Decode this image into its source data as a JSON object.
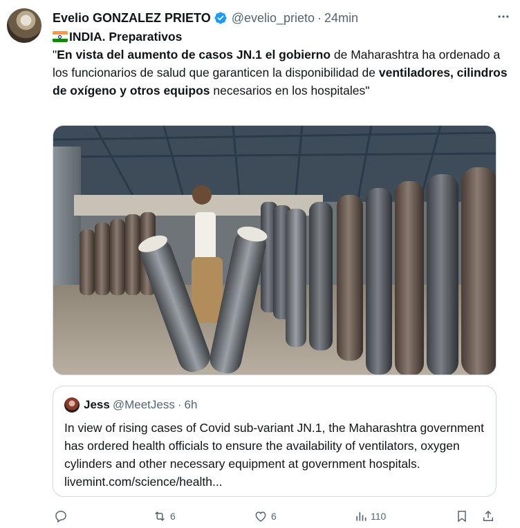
{
  "author": {
    "name": "Evelio GONZALEZ PRIETO",
    "handle": "@evelio_prieto",
    "separator": "·",
    "time": "24min"
  },
  "tweet": {
    "title": "INDIA. Preparativos",
    "text_1": "\"",
    "text_2_bold": "En vista del aumento de casos JN.1 el gobierno",
    "text_3": " de Maharashtra ha ordenado a los funcionarios de salud que garanticen la disponibilidad de ",
    "text_4_bold": "ventiladores, cilindros de oxígeno y otros equipos",
    "text_5": " necesarios en los hospitales\""
  },
  "media": {
    "description_icon": "photo-oxygen-cylinders"
  },
  "quote": {
    "name": "Jess",
    "handle": "@MeetJess",
    "separator": "·",
    "time": "6h",
    "text": "In view of rising cases of Covid sub-variant JN.1, the Maharashtra government has ordered health officials to ensure the availability of ventilators, oxygen cylinders and other necessary equipment at government hospitals. livemint.com/science/health..."
  },
  "actions": {
    "replies": "",
    "retweets": "6",
    "likes": "6",
    "views": "110"
  },
  "colors": {
    "accent": "#1d9bf0",
    "muted": "#536471",
    "border": "#cfd9de"
  }
}
